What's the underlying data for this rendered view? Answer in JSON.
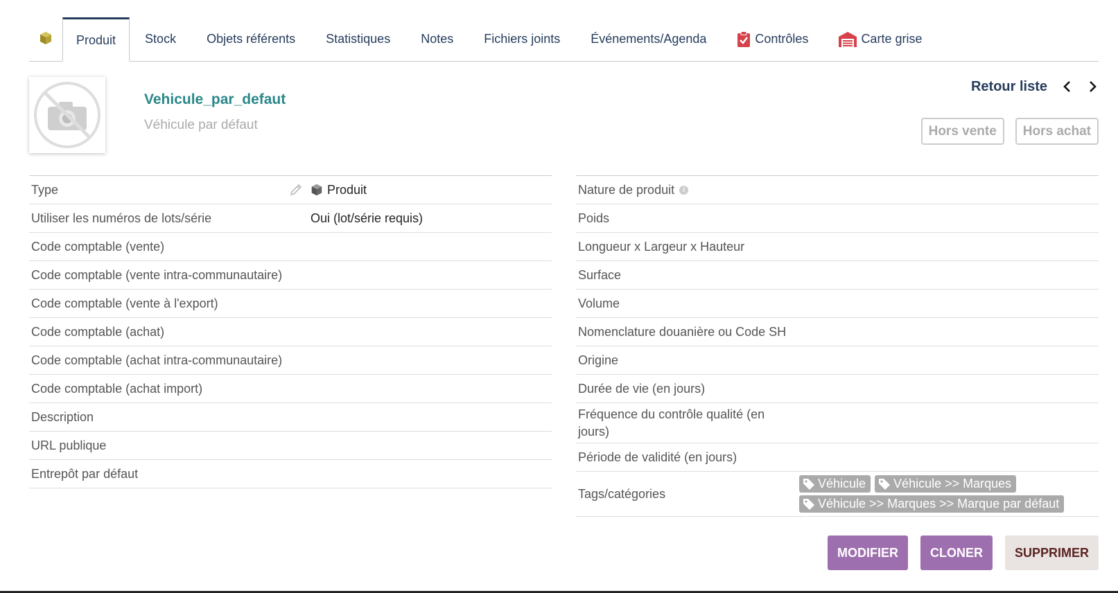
{
  "tabs": {
    "home_icon": "box-icon",
    "items": [
      {
        "label": "Produit",
        "active": true
      },
      {
        "label": "Stock"
      },
      {
        "label": "Objets référents"
      },
      {
        "label": "Statistiques"
      },
      {
        "label": "Notes"
      },
      {
        "label": "Fichiers joints"
      },
      {
        "label": "Événements/Agenda"
      },
      {
        "label": "Contrôles",
        "icon": "clipboard-check-icon"
      },
      {
        "label": "Carte grise",
        "icon": "garage-icon"
      }
    ]
  },
  "header": {
    "ref": "Vehicule_par_defaut",
    "label": "Véhicule par défaut",
    "photo_icon": "no-photo-icon",
    "back_label": "Retour liste",
    "status_sell": "Hors vente",
    "status_buy": "Hors achat"
  },
  "left_fields": [
    {
      "label": "Type",
      "value": "Produit"
    },
    {
      "label": "Utiliser les numéros de lots/série",
      "value": "Oui (lot/série requis)"
    },
    {
      "label": "Code comptable (vente)",
      "value": ""
    },
    {
      "label": "Code comptable (vente intra-communautaire)",
      "value": ""
    },
    {
      "label": "Code comptable (vente à l'export)",
      "value": ""
    },
    {
      "label": "Code comptable (achat)",
      "value": ""
    },
    {
      "label": "Code comptable (achat intra-communautaire)",
      "value": ""
    },
    {
      "label": "Code comptable (achat import)",
      "value": ""
    },
    {
      "label": "Description",
      "value": ""
    },
    {
      "label": "URL publique",
      "value": ""
    },
    {
      "label": "Entrepôt par défaut",
      "value": ""
    }
  ],
  "right_fields": [
    {
      "label": "Nature de produit"
    },
    {
      "label": "Poids"
    },
    {
      "label": "Longueur x Largeur x Hauteur"
    },
    {
      "label": "Surface"
    },
    {
      "label": "Volume"
    },
    {
      "label": "Nomenclature douanière ou Code SH"
    },
    {
      "label": "Origine"
    },
    {
      "label": "Durée de vie (en jours)"
    },
    {
      "label": "Fréquence du contrôle qualité (en jours)"
    },
    {
      "label": "Période de validité (en jours)"
    },
    {
      "label": "Tags/catégories"
    }
  ],
  "tags": [
    "Véhicule",
    "Véhicule >> Marques",
    "Véhicule >> Marques >> Marque par défaut"
  ],
  "info_glyph": "i",
  "actions": {
    "modify": "Modifier",
    "clone": "Cloner",
    "delete": "Supprimer"
  },
  "colors": {
    "accent": "#263c5c",
    "ref": "#2a8789",
    "primary_button": "#9e6fae",
    "tag": "#aaaaaa"
  }
}
